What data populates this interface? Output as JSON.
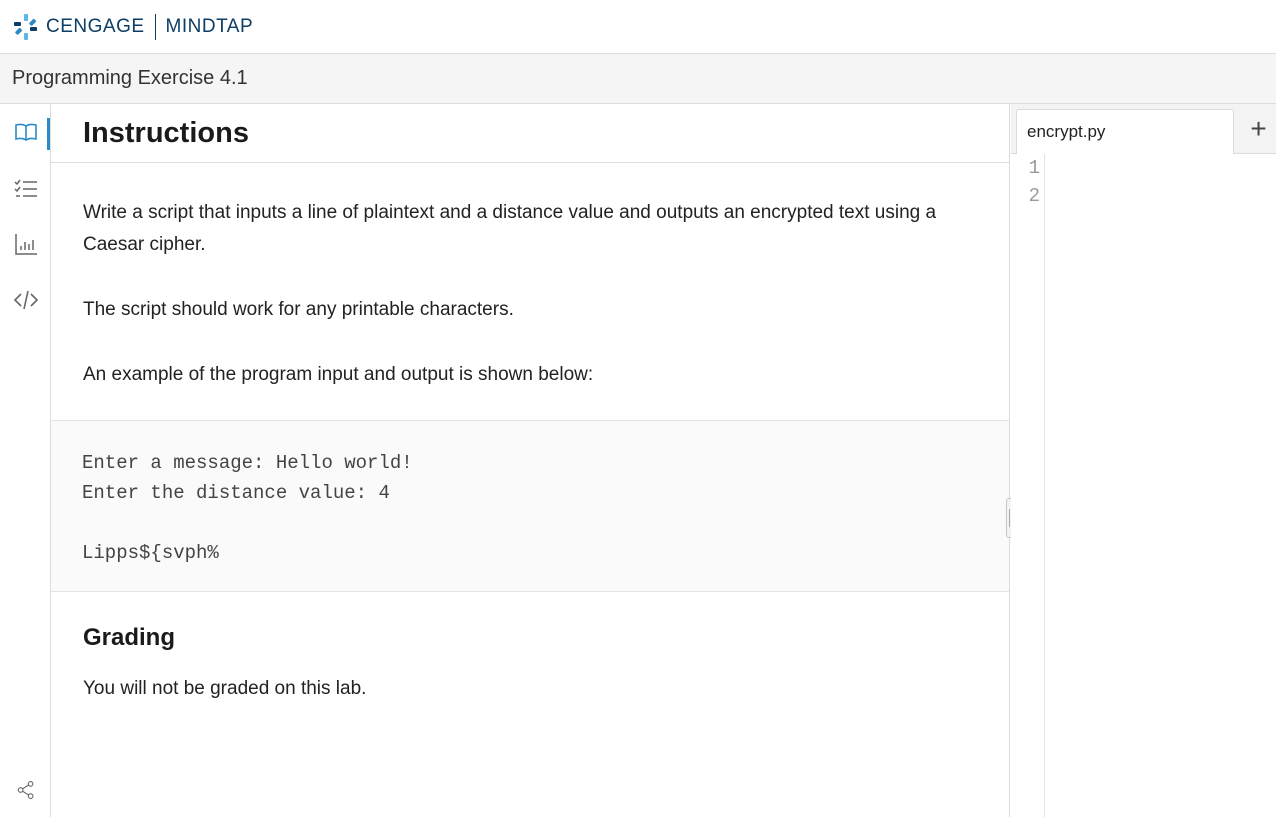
{
  "brand": {
    "name": "CENGAGE",
    "product": "MINDTAP"
  },
  "page": {
    "title": "Programming Exercise 4.1"
  },
  "rail": {
    "items": [
      {
        "icon": "book-icon",
        "label": "Instructions",
        "active": true
      },
      {
        "icon": "checklist-icon",
        "label": "Tasks",
        "active": false
      },
      {
        "icon": "chart-icon",
        "label": "Results",
        "active": false
      },
      {
        "icon": "code-icon",
        "label": "Code",
        "active": false
      }
    ],
    "bottom_icon": "share-icon"
  },
  "instructions": {
    "title": "Instructions",
    "paragraphs": [
      "Write a script that inputs a line of plaintext and a distance value and outputs an encrypted text using a Caesar cipher.",
      "The script should work for any printable characters.",
      "An example of the program input and output is shown below:"
    ],
    "example": [
      "Enter a message: Hello world!",
      "Enter the distance value: 4",
      "",
      "Lipps${svph%"
    ],
    "grading_title": "Grading",
    "grading_text": "You will not be graded on this lab."
  },
  "editor": {
    "tab_label": "encrypt.py",
    "add_label": "+",
    "line_numbers": [
      "1",
      "2"
    ]
  },
  "colors": {
    "accent": "#2b8bc4",
    "brand": "#0b3d66"
  }
}
